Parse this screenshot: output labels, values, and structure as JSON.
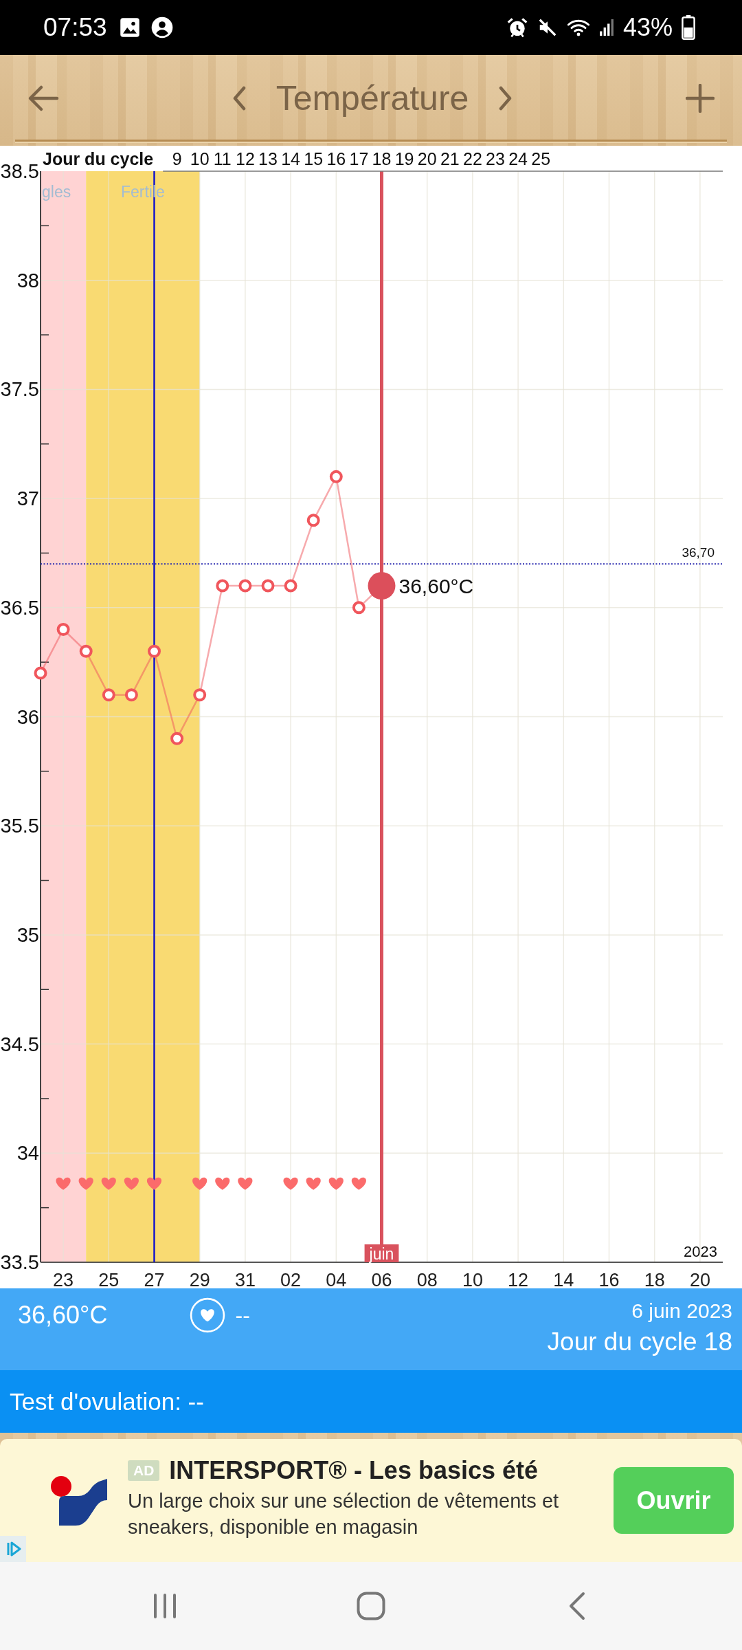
{
  "status_bar": {
    "time": "07:53",
    "battery": "43%"
  },
  "header": {
    "title": "Température"
  },
  "chart": {
    "cycle_axis": {
      "title": "Jour du cycle",
      "labels": [
        "9",
        "10",
        "11",
        "12",
        "13",
        "14",
        "15",
        "16",
        "17",
        "18",
        "19",
        "20",
        "21",
        "22",
        "23",
        "24",
        "25"
      ]
    },
    "phases": [
      {
        "label": "gles",
        "color": "#ffd3d3"
      },
      {
        "label": "Fertile",
        "color": "#f9da72"
      }
    ],
    "chart_data": {
      "type": "line",
      "grid": true,
      "xlabel": "2023",
      "categories": [
        null,
        "23",
        null,
        "25",
        null,
        "27",
        null,
        "29",
        null,
        "31",
        null,
        "02",
        null,
        "04",
        null,
        "06",
        null,
        "08",
        null,
        "10",
        null,
        "12",
        null,
        "14",
        null,
        "16",
        null,
        "18",
        null,
        "20",
        null
      ],
      "ylim": [
        33.5,
        38.5
      ],
      "yticks": [
        33.5,
        34,
        34.5,
        35,
        35.5,
        36,
        36.5,
        37,
        37.5,
        38,
        38.5
      ],
      "series": [
        {
          "color": "#f0565c",
          "marker": "circle",
          "values": [
            36.2,
            36.4,
            36.3,
            36.1,
            36.1,
            36.3,
            35.9,
            36.1,
            36.6,
            36.6,
            36.6,
            36.6,
            36.9,
            37.1,
            36.5,
            null,
            null,
            null,
            null,
            null,
            null,
            null,
            null,
            null,
            null,
            null,
            null,
            null,
            null,
            null,
            null
          ]
        },
        {
          "type": "scatter",
          "color": "#fb6b6b",
          "values": [
            null,
            33.86,
            33.86,
            33.86,
            33.86,
            33.86,
            null,
            33.86,
            33.86,
            33.86,
            null,
            33.86,
            33.86,
            33.86,
            33.86,
            null,
            null,
            null,
            null,
            null,
            null,
            null,
            null,
            null,
            null,
            null,
            null,
            null,
            null,
            null,
            null
          ]
        }
      ],
      "ref_lines": [
        {
          "axis": "y",
          "value": 36.7,
          "label": "36,70",
          "color": "#2b2bb0"
        },
        {
          "axis": "x",
          "value": "27",
          "color": "#1616c8"
        },
        {
          "axis": "x",
          "value": "06",
          "label": "juin",
          "color": "#d9525d"
        }
      ],
      "annotations": [
        {
          "text": "36,60°C",
          "x": "06",
          "y": 36.6
        }
      ]
    }
  },
  "day_summary": {
    "temperature": "36,60°C",
    "heart_value": "--",
    "date": "6 juin 2023",
    "cycle_day": "Jour du cycle 18"
  },
  "ovulation_test": {
    "text": "Test d'ovulation: --"
  },
  "ad": {
    "badge": "AD",
    "title": "INTERSPORT® - Les basics été",
    "description": "Un large choix sur une sélection de vêtements et sneakers, disponible en magasin",
    "button": "Ouvrir"
  }
}
